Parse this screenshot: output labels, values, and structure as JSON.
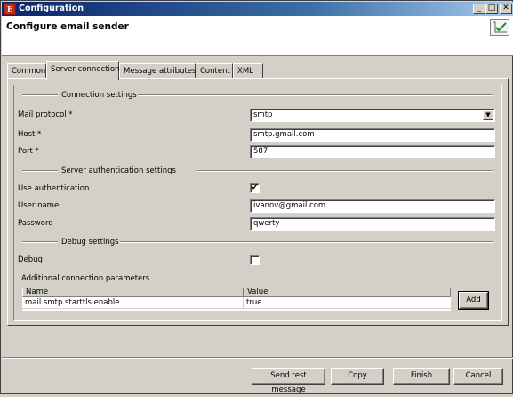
{
  "window": {
    "title": "Configuration",
    "app_icon": "E",
    "min": "_",
    "max": "□",
    "close": "✕"
  },
  "header": {
    "title": "Configure email sender",
    "icon": "checkmark-chart-icon"
  },
  "tabs": [
    {
      "label": "Common"
    },
    {
      "label": "Server connection"
    },
    {
      "label": "Message attributes"
    },
    {
      "label": "Content"
    },
    {
      "label": "XML"
    }
  ],
  "active_tab": "Server connection",
  "sections": {
    "connection": "Connection settings",
    "auth": "Server authentication settings",
    "debug": "Debug settings"
  },
  "fields": {
    "protocol": {
      "label": "Mail protocol *",
      "value": "smtp"
    },
    "host": {
      "label": "Host *",
      "value": "smtp.gmail.com"
    },
    "port": {
      "label": "Port *",
      "value": "587"
    },
    "use_auth": {
      "label": "Use authentication",
      "checked": true,
      "mark": "✔"
    },
    "username": {
      "label": "User name",
      "value": "ivanov@gmail.com"
    },
    "password": {
      "label": "Password",
      "value": "qwerty"
    },
    "debug": {
      "label": "Debug",
      "checked": false,
      "mark": ""
    }
  },
  "params": {
    "title": "Additional connection parameters",
    "columns": [
      "Name",
      "Value"
    ],
    "rows": [
      {
        "name": "mail.smtp.starttls.enable",
        "value": "true"
      }
    ],
    "add_label": "Add"
  },
  "buttons": {
    "send_test": "Send test message",
    "copy": "Copy",
    "finish": "Finish",
    "cancel": "Cancel"
  }
}
